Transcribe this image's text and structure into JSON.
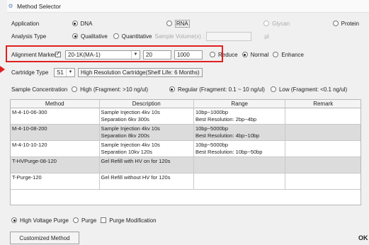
{
  "window": {
    "title": "Method Selector"
  },
  "application": {
    "label": "Application",
    "options": [
      {
        "label": "DNA",
        "selected": true,
        "enabled": true
      },
      {
        "label": "RNA",
        "selected": false,
        "enabled": true
      },
      {
        "label": "Glycan",
        "selected": false,
        "enabled": false
      },
      {
        "label": "Protein",
        "selected": false,
        "enabled": true
      }
    ]
  },
  "analysis": {
    "label": "Analysis Type",
    "qualitative": "Qualitative",
    "quantitative": "Quantitative",
    "sample_volume_label": "Sample Volume(x) :",
    "unit": "µl"
  },
  "alignment": {
    "label": "Alignment Marker",
    "marker_value": "20-1K(MA-1)",
    "low_value": "20",
    "high_value": "1000",
    "reduce": "Reduce",
    "normal": "Normal",
    "enhance": "Enhance"
  },
  "cartridge": {
    "label": "Cartridge Type",
    "slot": "S1",
    "description": "High Resolution Cartridge(Shelf Life: 6 Months)"
  },
  "concentration": {
    "label": "Sample Concentration",
    "high": "High (Fragment: >10 ng/ul)",
    "regular": "Regular (Fragment: 0.1 ~ 10 ng/ul)",
    "low": "Low (Fragment: <0.1 ng/ul)"
  },
  "table": {
    "headers": [
      "Method",
      "Description",
      "Range",
      "Remark"
    ],
    "rows": [
      {
        "method": "M-4-10-06-300",
        "desc1": "Sample Injection 4kv 10s",
        "desc2": "Separation 6kv 300s",
        "range1": "10bp~1000bp",
        "range2": "Best Resolution: 2bp~4bp",
        "remark": ""
      },
      {
        "method": "M-4-10-08-200",
        "desc1": "Sample Injection 4kv 10s",
        "desc2": "Separation 8kv 200s",
        "range1": "10bp~5000bp",
        "range2": "Best Resolution: 4bp~10bp",
        "remark": ""
      },
      {
        "method": "M-4-10-10-120",
        "desc1": "Sample Injection 4kv 10s",
        "desc2": "Separation 10kv 120s",
        "range1": "10bp~5000bp",
        "range2": "Best Resolution: 10bp~50bp",
        "remark": ""
      },
      {
        "method": "T-HVPurge-08-120",
        "desc1": "Gel Refill with HV on for 120s",
        "desc2": "",
        "range1": "",
        "range2": "",
        "remark": ""
      },
      {
        "method": "T-Purge-120",
        "desc1": "Gel Refill without HV for 120s",
        "desc2": "",
        "range1": "",
        "range2": "",
        "remark": ""
      }
    ]
  },
  "purge": {
    "high_voltage": "High Voltage Purge",
    "purge": "Purge",
    "modification": "Purge Modification"
  },
  "buttons": {
    "customized": "Customized Method",
    "ok": "OK"
  }
}
